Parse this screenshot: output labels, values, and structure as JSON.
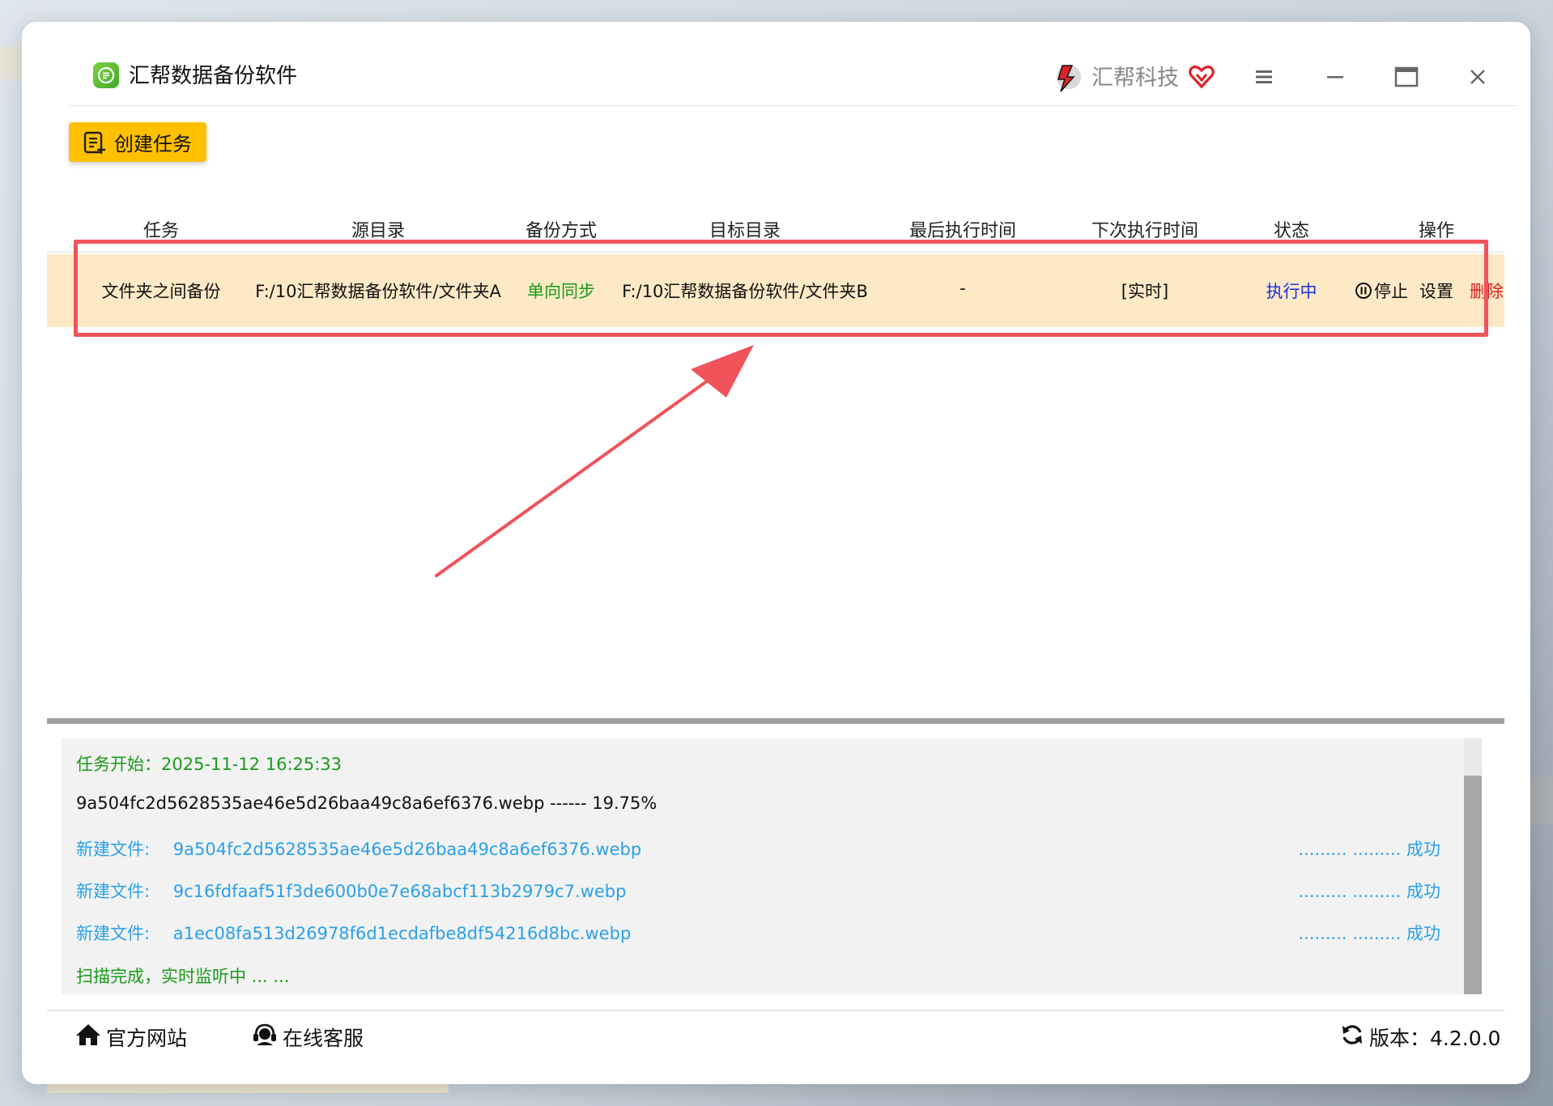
{
  "app": {
    "title": "汇帮数据备份软件",
    "brand": "汇帮科技"
  },
  "toolbar": {
    "create_label": "创建任务"
  },
  "table": {
    "headers": [
      "任务",
      "源目录",
      "备份方式",
      "目标目录",
      "最后执行时间",
      "下次执行时间",
      "状态",
      "操作"
    ],
    "rows": [
      {
        "task": "文件夹之间备份",
        "source": "F:/10汇帮数据备份软件/文件夹A",
        "mode": "单向同步",
        "target": "F:/10汇帮数据备份软件/文件夹B",
        "last_run": "-",
        "next_run": "[实时]",
        "status": "执行中",
        "actions": {
          "stop": "停止",
          "settings": "设置",
          "delete": "删除"
        }
      }
    ]
  },
  "log": {
    "start": "任务开始：2025-11-12 16:25:33",
    "progress": "9a504fc2d5628535ae46e5d26baa49c8a6ef6376.webp ------ 19.75%",
    "entries": [
      {
        "label": "新建文件:",
        "file": "9a504fc2d5628535ae46e5d26baa49c8a6ef6376.webp",
        "result": "......... ......... 成功"
      },
      {
        "label": "新建文件:",
        "file": "9c16fdfaaf51f3de600b0e7e68abcf113b2979c7.webp",
        "result": "......... ......... 成功"
      },
      {
        "label": "新建文件:",
        "file": "a1ec08fa513d26978f6d1ecdafbe8df54216d8bc.webp",
        "result": "......... ......... 成功"
      }
    ],
    "done": "扫描完成，实时监听中 ... ..."
  },
  "footer": {
    "website": "官方网站",
    "support": "在线客服",
    "version": "版本：4.2.0.0"
  },
  "colors": {
    "accent": "#ffc000",
    "row_highlight": "#fde9c6",
    "annotation": "#f0535a",
    "status_blue": "#1a2fe0",
    "sync_green": "#1a9a1a",
    "delete_red": "#e02020",
    "log_blue": "#2aa0e8"
  }
}
